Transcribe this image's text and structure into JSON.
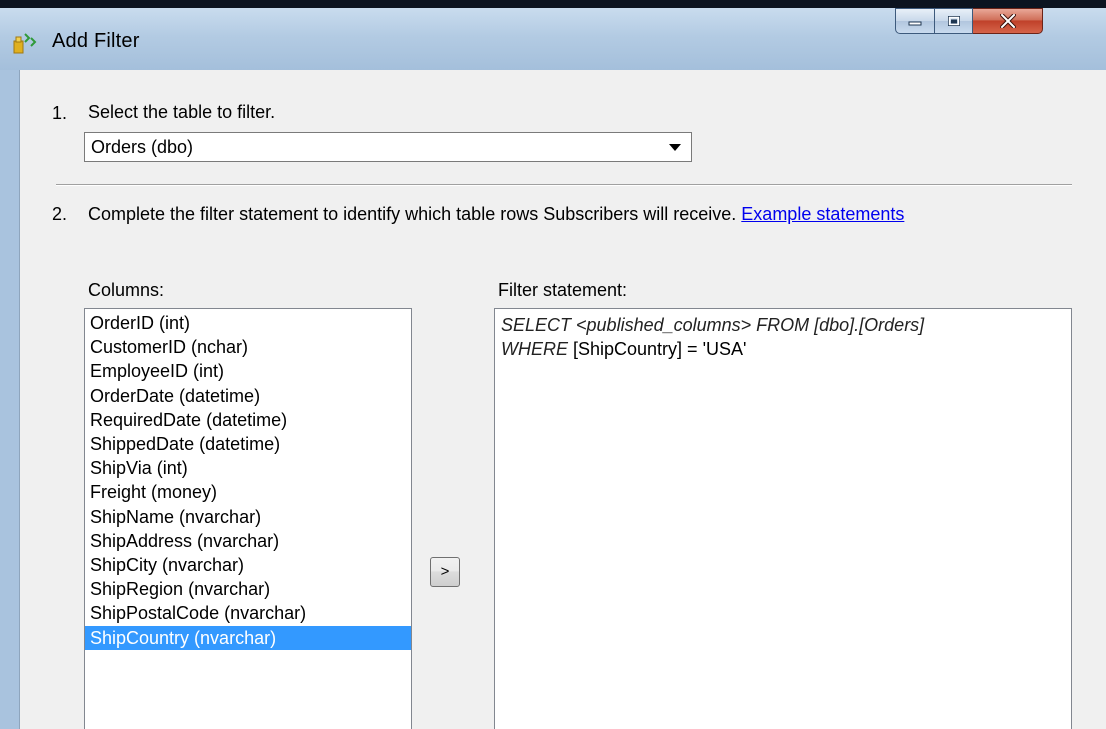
{
  "window": {
    "title": "Add Filter",
    "minimize_icon": "minimize-icon",
    "maximize_icon": "maximize-icon",
    "close_icon": "close-icon"
  },
  "step1": {
    "number": "1.",
    "text": "Select the table to filter.",
    "table_select_value": "Orders (dbo)"
  },
  "step2": {
    "number": "2.",
    "text": "Complete the filter statement to identify which table rows Subscribers will receive.",
    "link_text": "Example statements"
  },
  "columns": {
    "label": "Columns:",
    "items": [
      "OrderID (int)",
      "CustomerID (nchar)",
      "EmployeeID (int)",
      "OrderDate (datetime)",
      "RequiredDate (datetime)",
      "ShippedDate (datetime)",
      "ShipVia (int)",
      "Freight (money)",
      "ShipName (nvarchar)",
      "ShipAddress (nvarchar)",
      "ShipCity (nvarchar)",
      "ShipRegion (nvarchar)",
      "ShipPostalCode (nvarchar)",
      "ShipCountry (nvarchar)"
    ],
    "selected_index": 13
  },
  "add_button_label": ">",
  "filter": {
    "label": "Filter statement:",
    "line1": "SELECT <published_columns> FROM [dbo].[Orders]",
    "line2_keyword": "WHERE",
    "line2_rest": " [ShipCountry] = 'USA'"
  },
  "colors": {
    "selection": "#3399ff",
    "link": "#0000ee",
    "close_button": "#c0412a"
  }
}
